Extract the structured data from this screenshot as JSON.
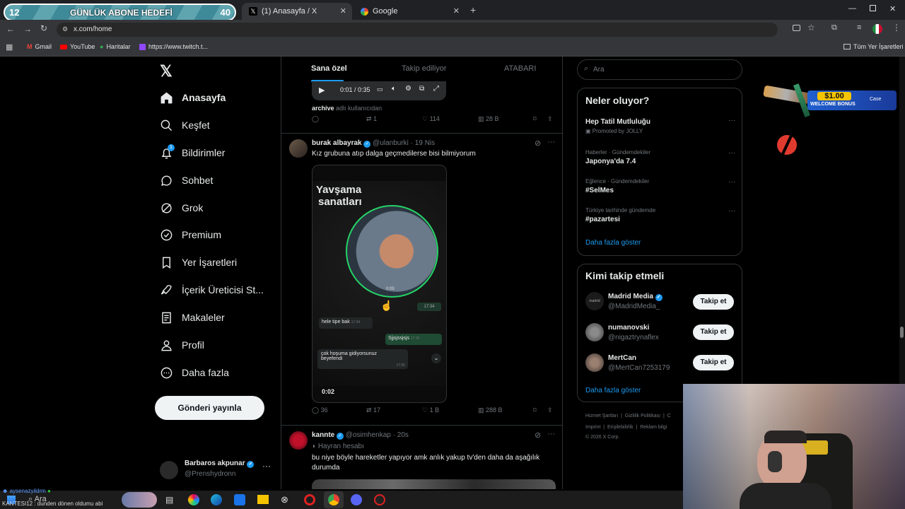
{
  "stream_overlay": {
    "sub_goal_current": "12",
    "sub_goal_title": "GÜNLÜK ABONE HEDEFİ",
    "sub_goal_target": "40",
    "ad_amount": "$1.00",
    "ad_text": "WELCOME BONUS",
    "ad_brand": "Case",
    "chat_user": "aysenazyildrm",
    "chat_line": "KANTESI12 : dunden dönen oldumu abi"
  },
  "browser": {
    "tabs": [
      {
        "title": "/ X"
      },
      {
        "title": "(1) Anasayfa / X"
      },
      {
        "title": "Google"
      }
    ],
    "url": "x.com/home",
    "bookmarks": [
      "Gmail",
      "YouTube",
      "Haritalar",
      "https://www.twitch.t..."
    ],
    "all_bookmarks": "Tüm Yer İşaretleri"
  },
  "nav": {
    "items": [
      "Anasayfa",
      "Keşfet",
      "Bildirimler",
      "Sohbet",
      "Grok",
      "Premium",
      "Yer İşaretleri",
      "İçerik Üreticisi St...",
      "Makaleler",
      "Profil",
      "Daha fazla"
    ],
    "notif_badge": "1",
    "post_button": "Gönderi yayınla",
    "account_name": "Barbaros akpunar",
    "account_handle": "@Prenshydronn"
  },
  "feed": {
    "tabs": [
      "Sana özel",
      "Takip ediliyor",
      "ATABARI"
    ],
    "prev_post": {
      "video_time": "0:01 / 0:35",
      "caption_user": "archive",
      "caption_rest": "adlı kullanıcıdan",
      "replies": "",
      "reposts": "1",
      "likes": "114",
      "views": "28 B"
    },
    "post1": {
      "name": "burak albayrak",
      "handle": "@ulanburki",
      "date": "· 19 Nis",
      "text": "Kız grubuna atıp dalga geçmedilerse bisi bilmiyorum",
      "video_title_1": "Yavşama",
      "video_title_2": "sanatları",
      "bubble_time": "0:09",
      "msg1_time": "17:34",
      "msg2": "hele tipe bak",
      "msg2_time": "17:34",
      "msg3": "Sjjsjssjsjs",
      "msg3_time": "17:35",
      "msg4_l1": "çok hoşuma gidiyorsunuz",
      "msg4_l2": "beyefendi",
      "msg4_time": "17:35",
      "video_time": "0:02",
      "replies": "36",
      "reposts": "17",
      "likes": "1 B",
      "views": "288 B"
    },
    "post2": {
      "name": "kannte",
      "handle": "@osimhenkap",
      "date": "· 20s",
      "badge": "Hayran hesabı",
      "text_l1": "bu niye böyle hareketler yapıyor amk anlık yakup tv'den daha da aşağılık",
      "text_l2": "durumda"
    }
  },
  "sidebar": {
    "search_placeholder": "Ara",
    "trends_title": "Neler oluyor?",
    "trends": [
      {
        "context": "",
        "name": "Hep Tatil Mutluluğu",
        "extra": "Promoted by JOLLY"
      },
      {
        "context": "Haberler · Gündemdekiler",
        "name": "Japonya'da 7.4",
        "extra": ""
      },
      {
        "context": "Eğlence · Gündemdekiler",
        "name": "#SelMes",
        "extra": ""
      },
      {
        "context": "Türkiye tarihinde gündemde",
        "name": "#pazartesi",
        "extra": ""
      }
    ],
    "trends_more": "Daha fazla göster",
    "follow_title": "Kimi takip etmeli",
    "follow": [
      {
        "name": "Madrid Media",
        "handle": "@MadridMedia_",
        "button": "Takip et",
        "avatar_text": "madrid"
      },
      {
        "name": "numanovski",
        "handle": "@nigaztrynaflex",
        "button": "Takip et"
      },
      {
        "name": "MertCan",
        "handle": "@MertCan7253179",
        "button": "Takip et"
      }
    ],
    "follow_more": "Daha fazla göster",
    "footer_1": [
      "Hizmet Şartları",
      "Gizlilik Politikası",
      "C"
    ],
    "footer_2": [
      "Imprint",
      "Erişilebilirlik",
      "Reklam bilgi"
    ],
    "footer_3": "© 2026 X Corp."
  },
  "taskbar": {
    "search": "Ara"
  }
}
